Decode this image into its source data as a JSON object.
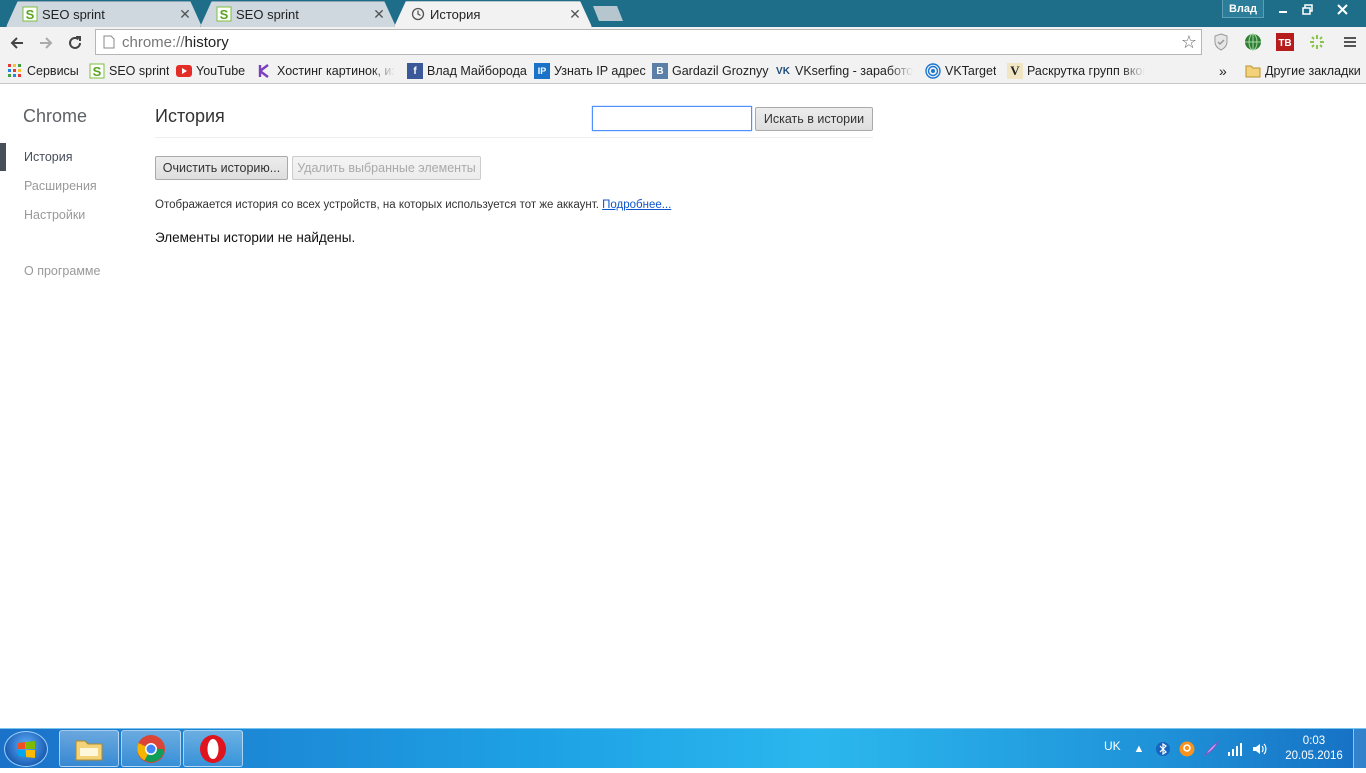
{
  "window": {
    "user_label": "Влад",
    "minimize_icon": "minimize-icon",
    "maximize_icon": "restore-icon",
    "close_icon": "close-icon"
  },
  "tabs": [
    {
      "title": "SEO sprint",
      "icon": "seosprint-icon",
      "active": false
    },
    {
      "title": "SEO sprint",
      "icon": "seosprint-icon",
      "active": false
    },
    {
      "title": "История",
      "icon": "history-icon",
      "active": true
    }
  ],
  "toolbar": {
    "url_scheme": "chrome://",
    "url_path": "history"
  },
  "bookmarks": [
    {
      "label": "Сервисы",
      "icon": "apps-grid-icon"
    },
    {
      "label": "SEO sprint",
      "icon": "seosprint-icon"
    },
    {
      "label": "YouTube",
      "icon": "youtube-icon"
    },
    {
      "label": "Хостинг картинок, из",
      "icon": "k-icon"
    },
    {
      "label": "Влад Майборода",
      "icon": "facebook-icon"
    },
    {
      "label": "Узнать IP адрес",
      "icon": "ip-icon"
    },
    {
      "label": "Gardazil Groznyy",
      "icon": "b-icon"
    },
    {
      "label": "VKserfing - заработо",
      "icon": "vk-icon"
    },
    {
      "label": "VKTarget",
      "icon": "vktarget-icon"
    },
    {
      "label": "Раскрутка групп вкон",
      "icon": "v-icon"
    }
  ],
  "bookmarks_overflow": "»",
  "other_bookmarks": "Другие закладки",
  "sidebar": {
    "brand": "Chrome",
    "items": [
      "История",
      "Расширения",
      "Настройки"
    ],
    "about": "О программе"
  },
  "main": {
    "title": "История",
    "search_value": "",
    "search_button": "Искать в истории",
    "clear_button": "Очистить историю...",
    "remove_button": "Удалить выбранные элементы",
    "sync_text": "Отображается история со всех устройств, на которых используется тот же аккаунт.",
    "sync_link": "Подробнее...",
    "empty_text": "Элементы истории не найдены."
  },
  "taskbar": {
    "language": "UK",
    "time": "0:03",
    "date": "20.05.2016"
  }
}
